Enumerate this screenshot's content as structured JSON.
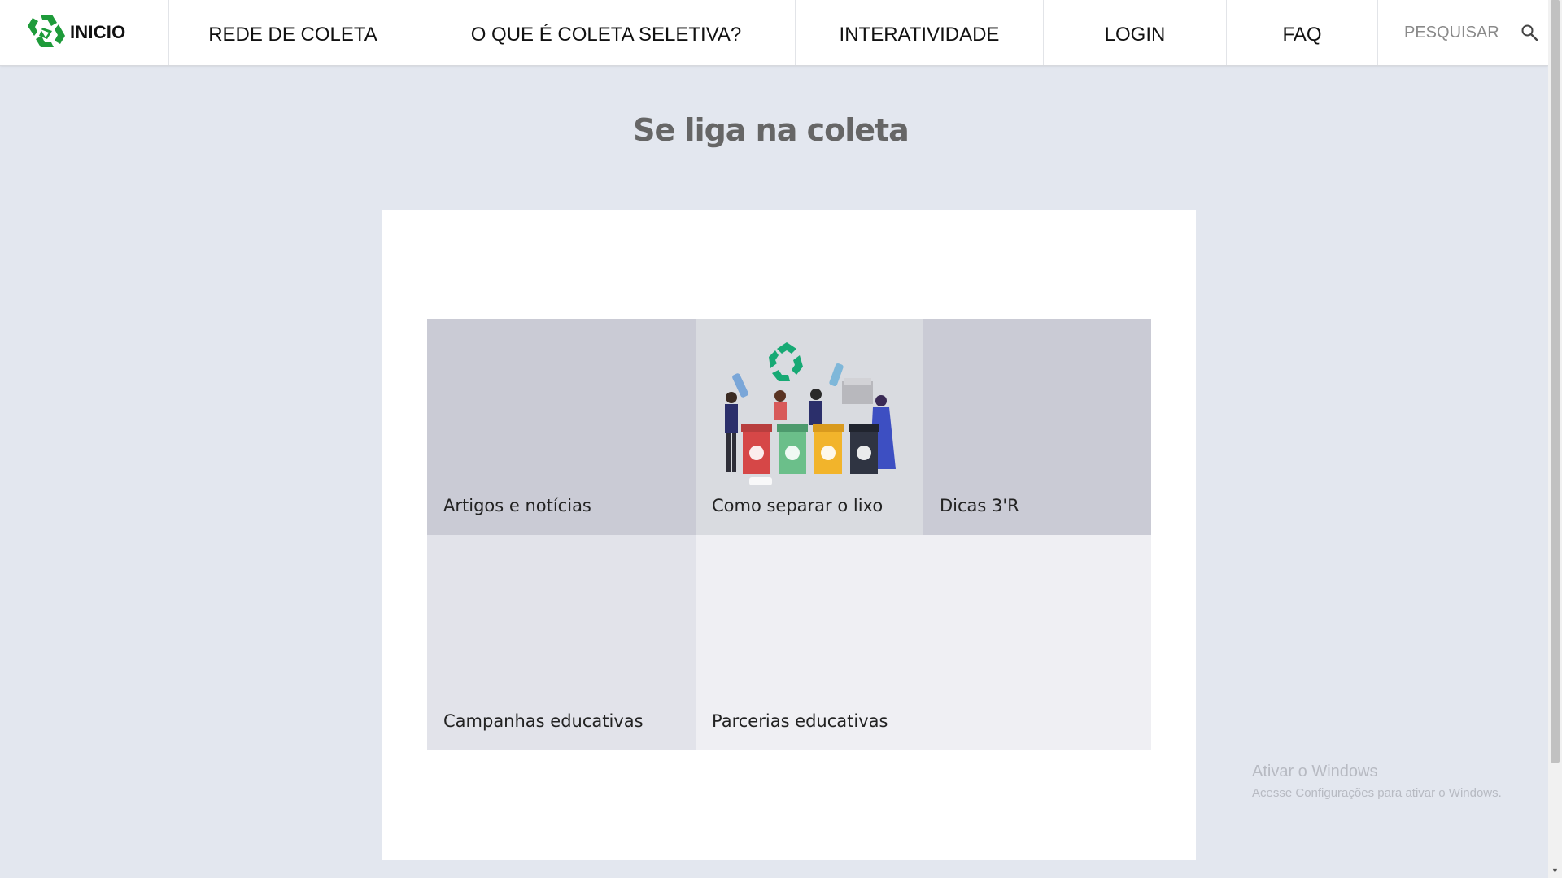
{
  "header": {
    "brand": "INICIO",
    "nav": [
      {
        "label": "REDE DE COLETA"
      },
      {
        "label": "O QUE É COLETA SELETIVA?"
      },
      {
        "label": "INTERATIVIDADE"
      },
      {
        "label": "LOGIN"
      },
      {
        "label": "FAQ"
      }
    ],
    "search_label": "PESQUISAR"
  },
  "main": {
    "title": "Se liga na coleta",
    "tiles": [
      {
        "label": "Artigos e notícias"
      },
      {
        "label": "Como separar o lixo"
      },
      {
        "label": "Dicas 3'R"
      },
      {
        "label": "Campanhas educativas"
      },
      {
        "label": "Parcerias educativas"
      }
    ]
  },
  "watermark": {
    "title": "Ativar o Windows",
    "subtitle": "Acesse Configurações para ativar o Windows."
  },
  "colors": {
    "page_bg": "#e3e7ef",
    "tile_dark": "#cacbd5",
    "tile_light": "#e2e3ea",
    "tile_lighter": "#efeff3",
    "tile_image_bg": "#d9dbe0",
    "brand_green": "#1e9b3a"
  }
}
